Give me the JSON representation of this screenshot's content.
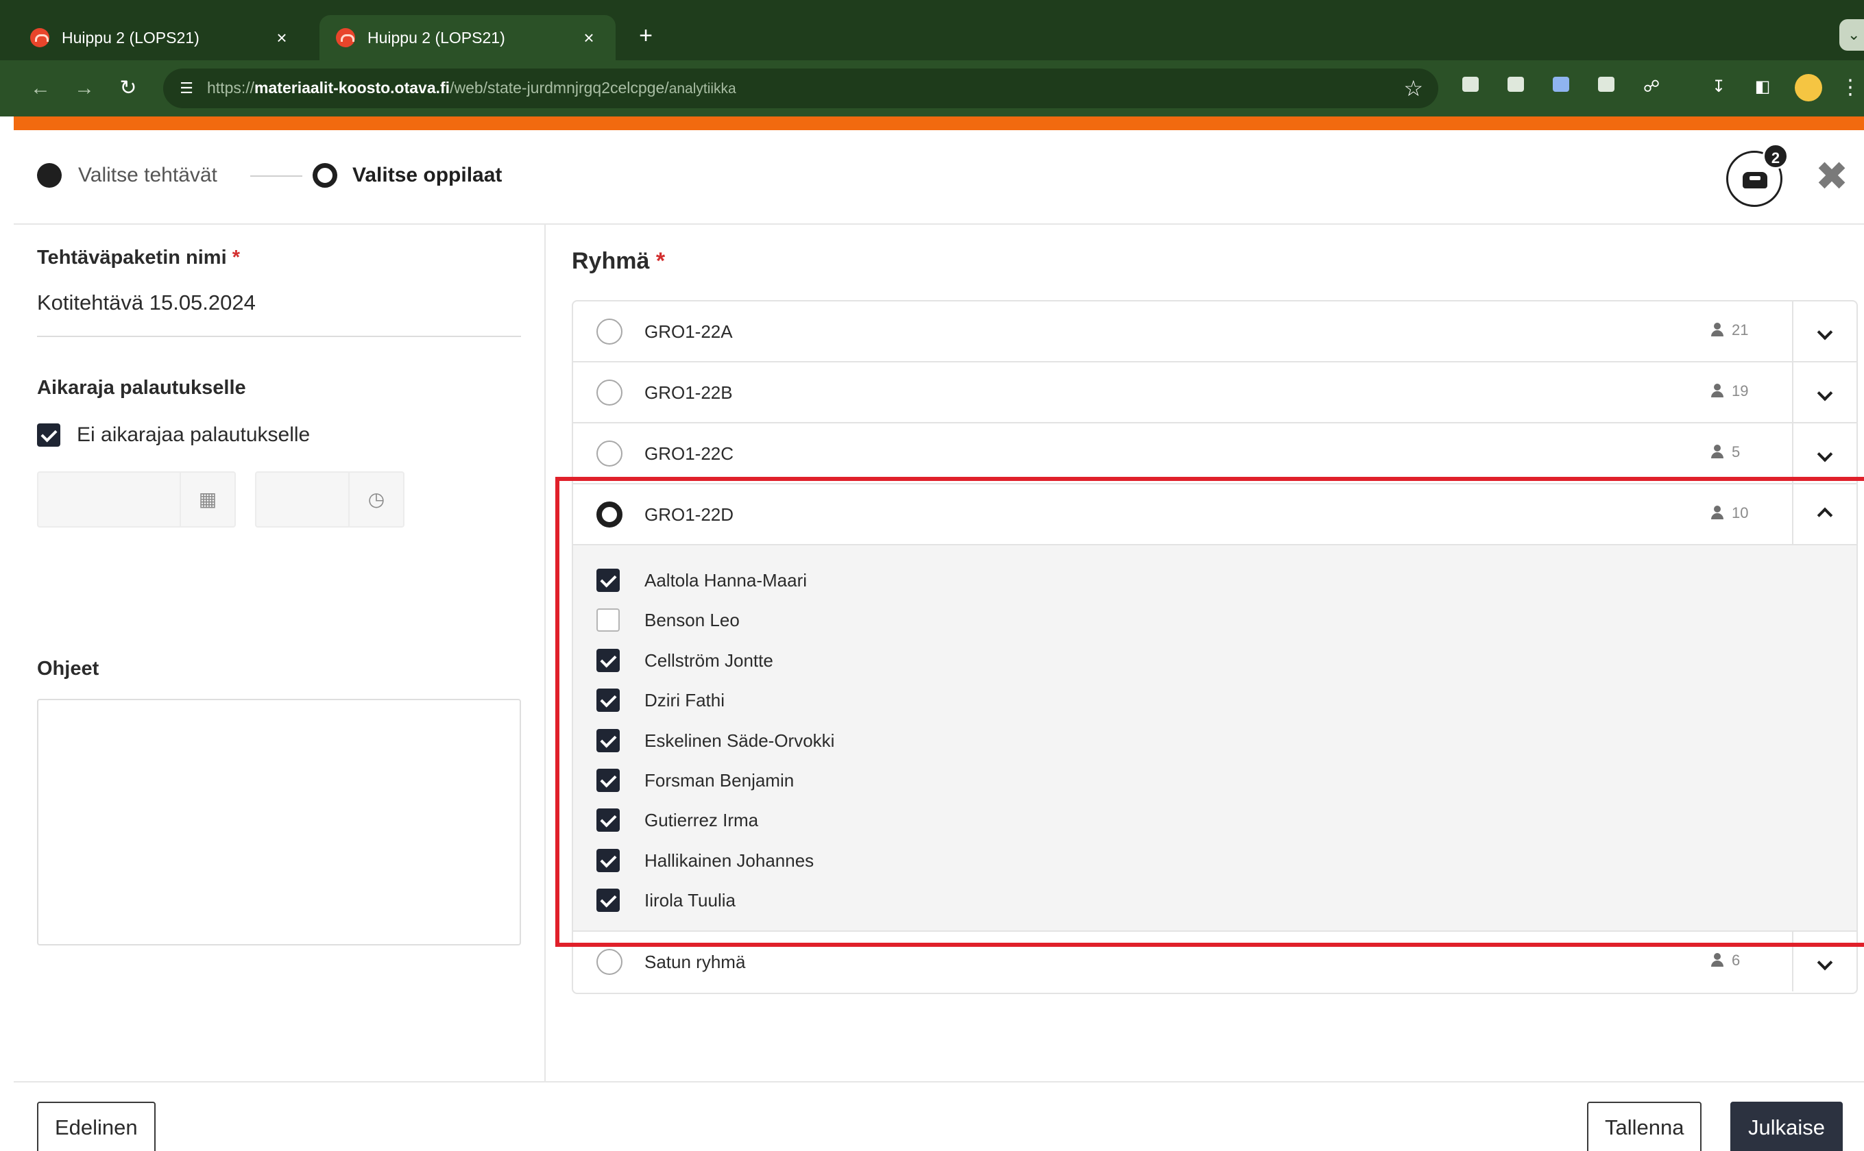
{
  "browser": {
    "tabs": [
      {
        "title": "Huippu 2 (LOPS21)",
        "active": false
      },
      {
        "title": "Huippu 2 (LOPS21)",
        "active": true
      }
    ],
    "close_glyph": "×",
    "new_tab_glyph": "+",
    "url": {
      "scheme": "https://",
      "host": "materiaalit-koosto.otava.fi",
      "path": "/web/state-jurdmnjrgq2celcpge/",
      "suffix": "analytiikka"
    }
  },
  "stepper": {
    "step1": "Valitse tehtävät",
    "step2": "Valitse oppilaat",
    "inbox_count": "2"
  },
  "left": {
    "name_label": "Tehtäväpaketin nimi",
    "required_mark": "*",
    "name_value": "Kotitehtävä 15.05.2024",
    "deadline_label": "Aikaraja palautukselle",
    "no_deadline_label": "Ei aikarajaa palautukselle",
    "no_deadline_checked": true,
    "instructions_label": "Ohjeet"
  },
  "right": {
    "group_label": "Ryhmä",
    "required_mark": "*",
    "groups": [
      {
        "name": "GRO1-22A",
        "count": "21",
        "selected": false,
        "expanded": false
      },
      {
        "name": "GRO1-22B",
        "count": "19",
        "selected": false,
        "expanded": false
      },
      {
        "name": "GRO1-22C",
        "count": "5",
        "selected": false,
        "expanded": false
      },
      {
        "name": "GRO1-22D",
        "count": "10",
        "selected": true,
        "expanded": true
      },
      {
        "name": "Satun ryhmä",
        "count": "6",
        "selected": false,
        "expanded": false
      }
    ],
    "students": [
      {
        "name": "Aaltola Hanna-Maari",
        "checked": true
      },
      {
        "name": "Benson Leo",
        "checked": false
      },
      {
        "name": "Cellström Jontte",
        "checked": true
      },
      {
        "name": "Dziri Fathi",
        "checked": true
      },
      {
        "name": "Eskelinen Säde-Orvokki",
        "checked": true
      },
      {
        "name": "Forsman Benjamin",
        "checked": true
      },
      {
        "name": "Gutierrez Irma",
        "checked": true
      },
      {
        "name": "Hallikainen Johannes",
        "checked": true
      },
      {
        "name": "Iirola Tuulia",
        "checked": true
      }
    ]
  },
  "footer": {
    "prev_label": "Edelinen",
    "save_label": "Tallenna",
    "publish_label": "Julkaise"
  },
  "colors": {
    "browser_frame": "#1f3d1c",
    "accent_bar": "#f26a0f",
    "highlight": "#e0202a",
    "primary_button": "#2c3240"
  }
}
